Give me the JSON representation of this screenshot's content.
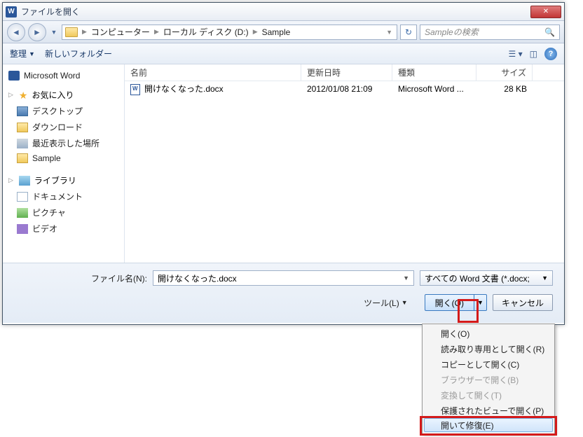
{
  "title": "ファイルを開く",
  "nav": {
    "path": [
      "コンピューター",
      "ローカル ディスク (D:)",
      "Sample"
    ],
    "search_placeholder": "Sampleの検索"
  },
  "toolbar": {
    "organize": "整理",
    "new_folder": "新しいフォルダー"
  },
  "sidebar": {
    "app": "Microsoft Word",
    "fav_label": "お気に入り",
    "fav_items": [
      "デスクトップ",
      "ダウンロード",
      "最近表示した場所",
      "Sample"
    ],
    "lib_label": "ライブラリ",
    "lib_items": [
      "ドキュメント",
      "ピクチャ",
      "ビデオ"
    ]
  },
  "columns": {
    "name": "名前",
    "date": "更新日時",
    "type": "種類",
    "size": "サイズ"
  },
  "file": {
    "name": "開けなくなった.docx",
    "date": "2012/01/08 21:09",
    "type": "Microsoft Word ...",
    "size": "28 KB"
  },
  "bottom": {
    "filename_label": "ファイル名(N):",
    "filename_value": "開けなくなった.docx",
    "filter": "すべての Word 文書 (*.docx;",
    "tools": "ツール(L)",
    "open": "開く(O)",
    "cancel": "キャンセル"
  },
  "menu": {
    "items": [
      {
        "label": "開く(O)",
        "disabled": false
      },
      {
        "label": "読み取り専用として開く(R)",
        "disabled": false
      },
      {
        "label": "コピーとして開く(C)",
        "disabled": false
      },
      {
        "label": "ブラウザーで開く(B)",
        "disabled": true
      },
      {
        "label": "変換して開く(T)",
        "disabled": true
      },
      {
        "label": "保護されたビューで開く(P)",
        "disabled": false
      },
      {
        "label": "開いて修復(E)",
        "disabled": false
      }
    ]
  }
}
